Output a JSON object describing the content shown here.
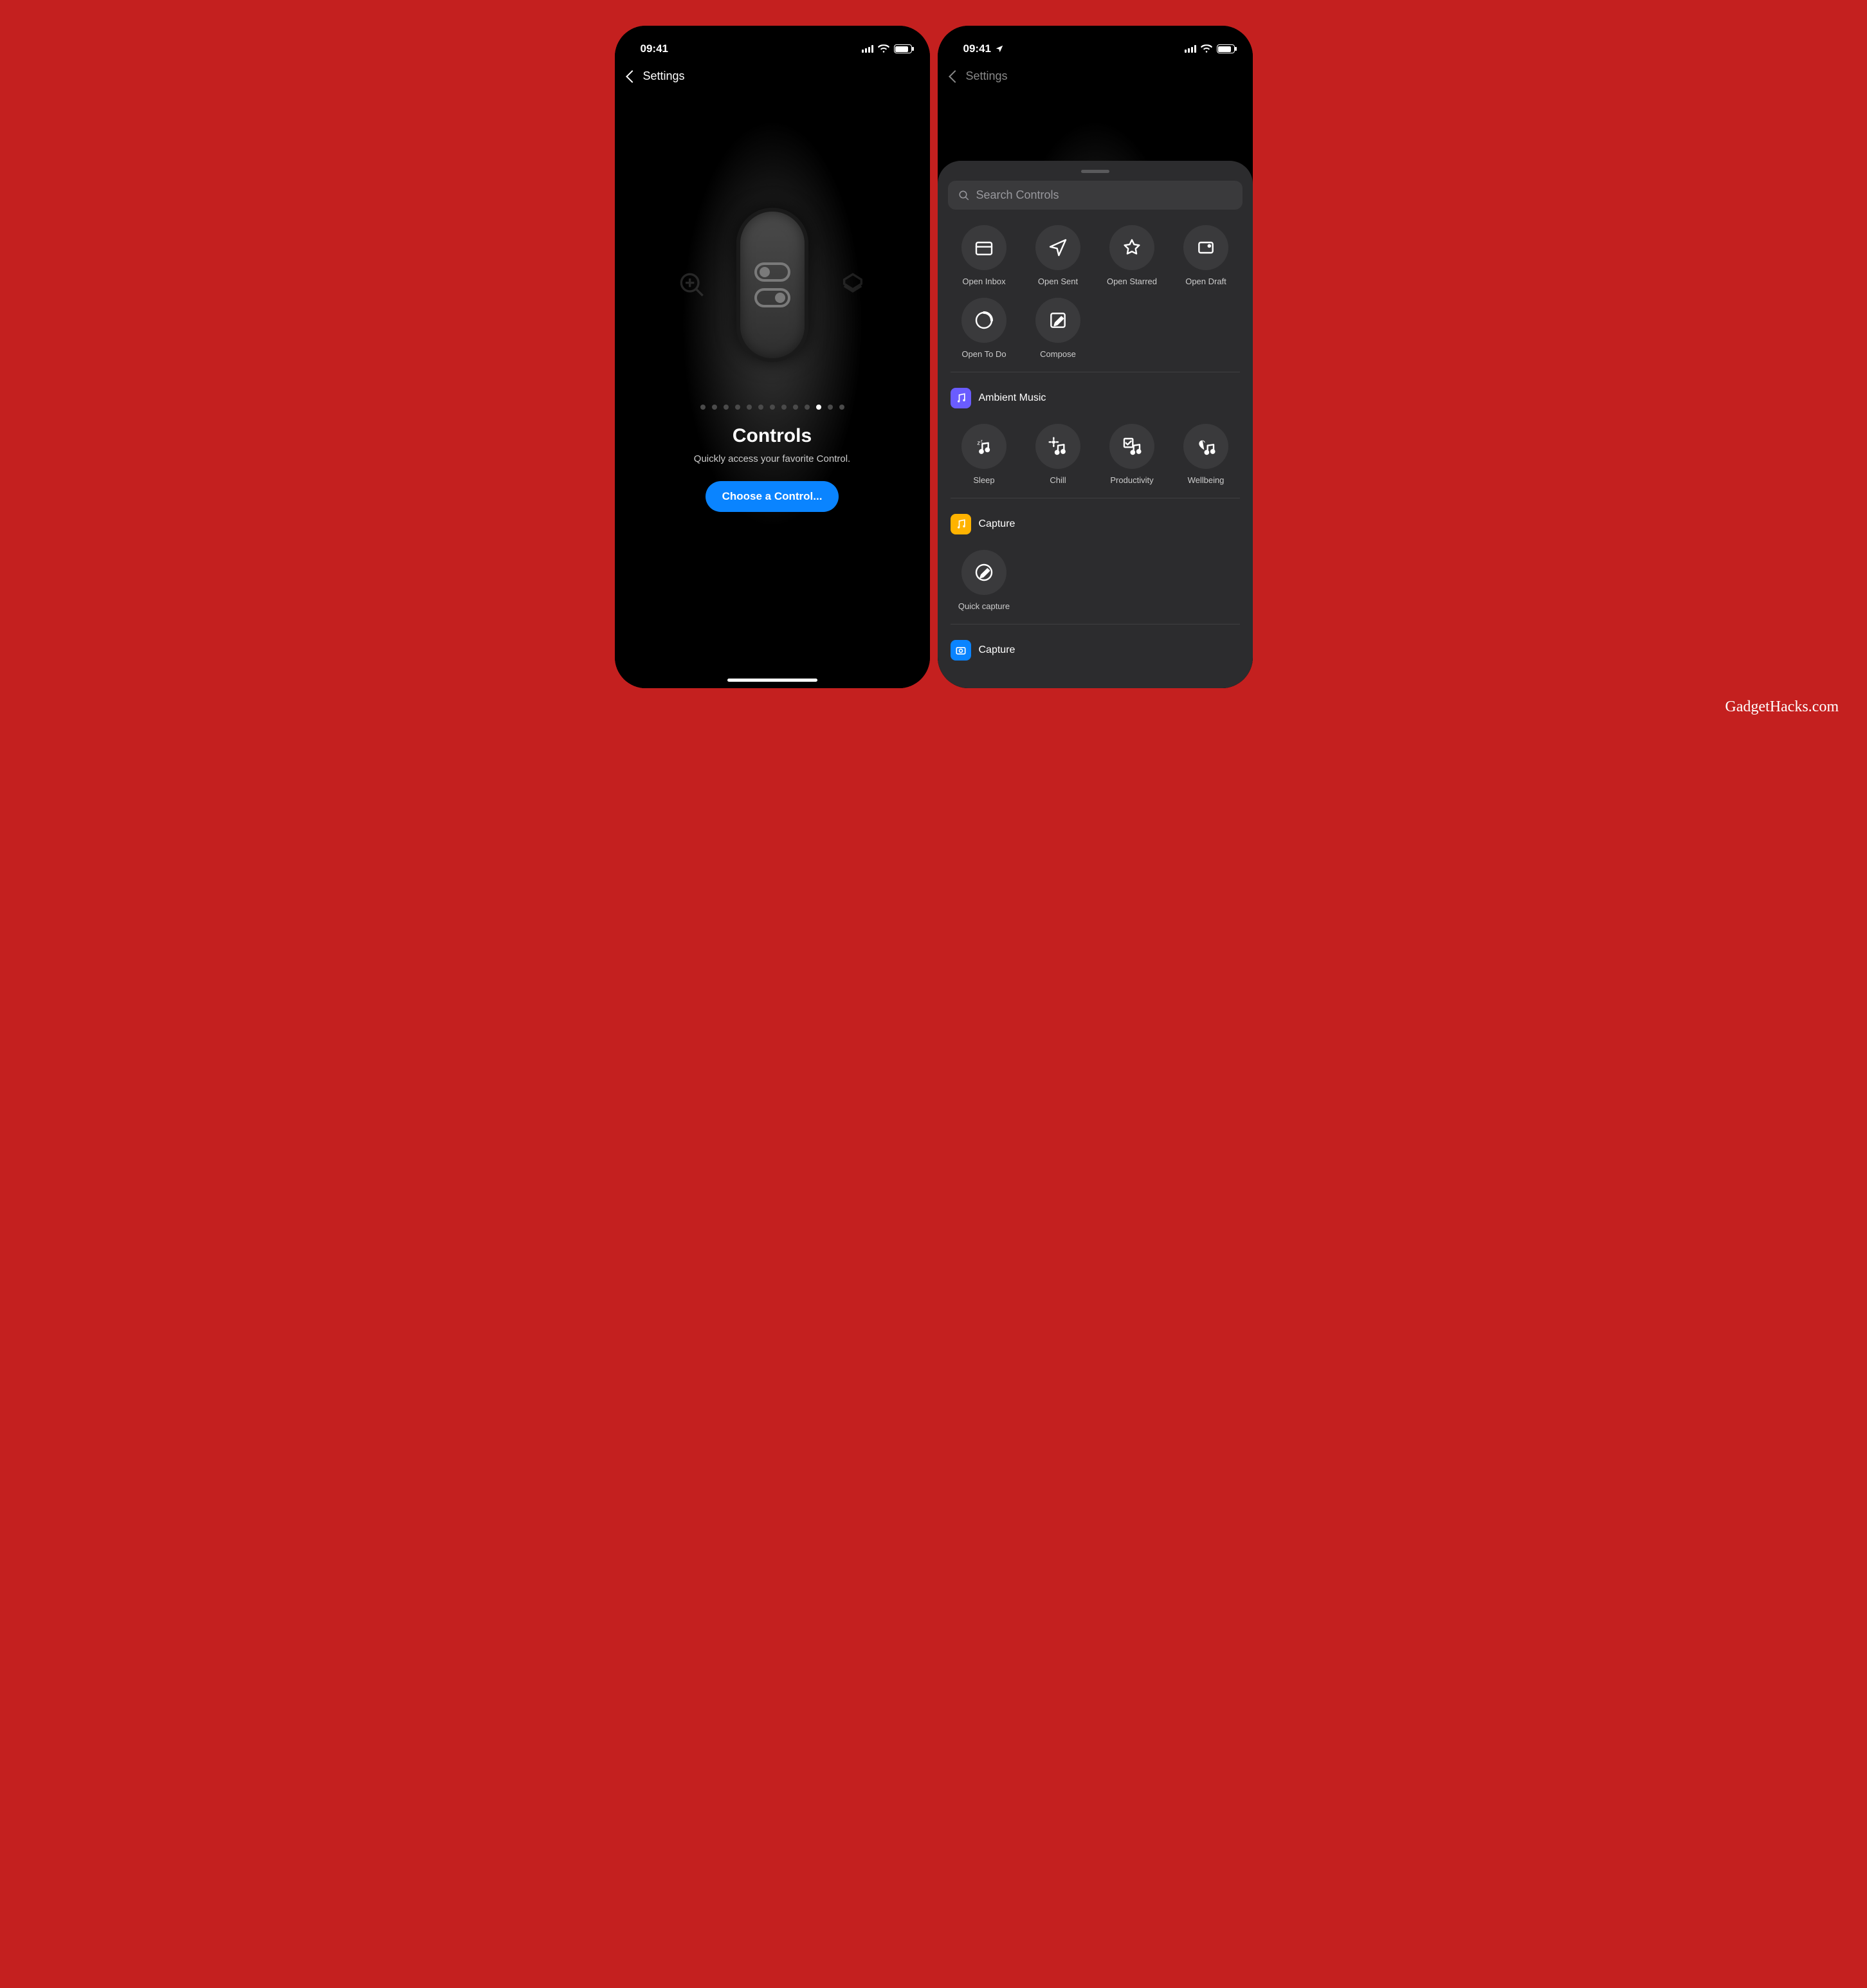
{
  "status_time": "09:41",
  "left_nav": "Settings",
  "pane1": {
    "title": "Controls",
    "subtitle": "Quickly access your favorite Control.",
    "button": "Choose a Control...",
    "total_dots": 13,
    "active_dot": 10
  },
  "sheet": {
    "search_placeholder": "Search Controls",
    "top_actions": [
      {
        "icon": "folder",
        "label": "Open Inbox"
      },
      {
        "icon": "send",
        "label": "Open Sent"
      },
      {
        "icon": "star",
        "label": "Open Starred"
      },
      {
        "icon": "draft",
        "label": "Open Draft"
      },
      {
        "icon": "timer",
        "label": "Open To Do"
      },
      {
        "icon": "compose",
        "label": "Compose"
      }
    ],
    "sections": [
      {
        "app": "Ambient Music",
        "app_color": "#6a5cff",
        "app_icon": "music",
        "items": [
          {
            "icon": "sleep_music",
            "label": "Sleep"
          },
          {
            "icon": "chill_music",
            "label": "Chill"
          },
          {
            "icon": "productivity_music",
            "label": "Productivity"
          },
          {
            "icon": "wellbeing_music",
            "label": "Wellbeing"
          }
        ]
      },
      {
        "app": "Capture",
        "app_color": "#ffb300",
        "app_icon": "capture",
        "items": [
          {
            "icon": "quick_capture",
            "label": "Quick capture"
          }
        ]
      },
      {
        "app": "Capture",
        "app_color": "#0a84ff",
        "app_icon": "camera",
        "items": []
      }
    ]
  },
  "watermark": "GadgetHacks.com"
}
